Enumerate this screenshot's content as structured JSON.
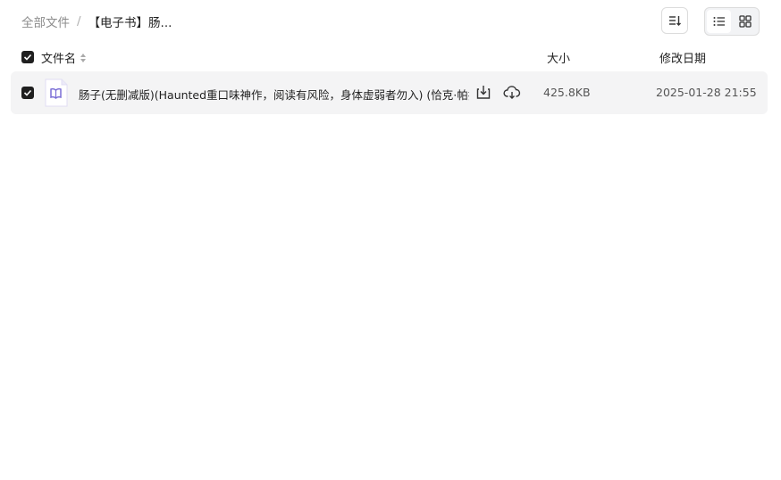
{
  "breadcrumb": {
    "root": "全部文件",
    "separator": "/",
    "current": "【电子书】肠..."
  },
  "toolbar": {
    "sort_icon": "sort-icon",
    "view_list_icon": "list-view-icon",
    "view_grid_icon": "grid-view-icon",
    "active_view": "list"
  },
  "table": {
    "headers": {
      "name": "文件名",
      "size": "大小",
      "date": "修改日期"
    },
    "rows": [
      {
        "name": "肠子(无删减版)(Haunted重口味神作，阅读有风险，身体虚弱者勿入) (恰克·帕拉尼",
        "size": "425.8KB",
        "date": "2025-01-28 21:55",
        "checked": true,
        "icon": "ebook-file-icon"
      }
    ]
  },
  "colors": {
    "accent": "#1f1f1f",
    "row_bg": "#f4f4f5",
    "file_icon": "#7b6fd6"
  }
}
